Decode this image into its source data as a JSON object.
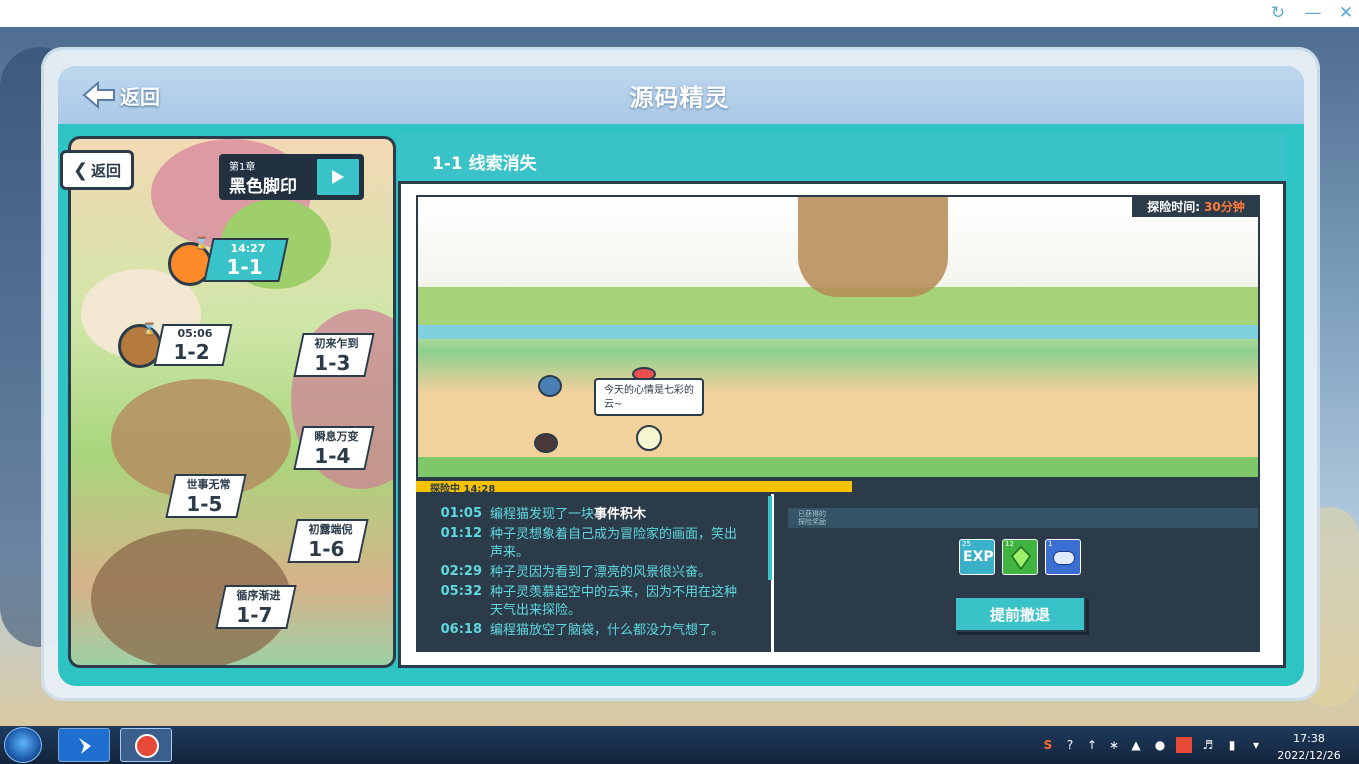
{
  "window": {
    "refresh_icon": "refresh-icon",
    "minimize_label": "—",
    "close_label": "✕"
  },
  "header": {
    "title": "源码精灵",
    "back_label": "返回"
  },
  "map": {
    "back_label": "返回",
    "chapter_number": "第1章",
    "chapter_name": "黑色脚印",
    "stages": [
      {
        "code": "1-1",
        "name": "",
        "time": "14:27",
        "active": true
      },
      {
        "code": "1-2",
        "name": "",
        "time": "05:06",
        "active": false
      },
      {
        "code": "1-3",
        "name": "初来乍到",
        "time": "",
        "active": false
      },
      {
        "code": "1-4",
        "name": "瞬息万变",
        "time": "",
        "active": false
      },
      {
        "code": "1-5",
        "name": "世事无常",
        "time": "",
        "active": false
      },
      {
        "code": "1-6",
        "name": "初露端倪",
        "time": "",
        "active": false
      },
      {
        "code": "1-7",
        "name": "循序渐进",
        "time": "",
        "active": false
      }
    ]
  },
  "content": {
    "title": "1-1 线索消失",
    "explore_time_label": "探险时间:",
    "explore_time_value": "30分钟",
    "speech_bubble": "今天的心情是七彩的云~",
    "progress_label": "探险中 14:28",
    "progress_fraction": 0.516,
    "log": [
      {
        "time": "01:05",
        "text": "编程猫发现了一块",
        "highlight": "事件积木"
      },
      {
        "time": "01:12",
        "text": "种子灵想象着自己成为冒险家的画面，笑出声来。",
        "highlight": ""
      },
      {
        "time": "02:29",
        "text": "种子灵因为看到了漂亮的风景很兴奋。",
        "highlight": ""
      },
      {
        "time": "05:32",
        "text": "种子灵羡慕起空中的云来，因为不用在这种天气出来探险。",
        "highlight": ""
      },
      {
        "time": "06:18",
        "text": "编程猫放空了脑袋，什么都没力气想了。",
        "highlight": ""
      }
    ],
    "rewards": {
      "title_line1": "已获得的",
      "title_line2": "探险奖励",
      "items": [
        {
          "icon": "exp-icon",
          "qty": "25",
          "color": "#3bb0c9"
        },
        {
          "icon": "green-crystal-icon",
          "qty": "12",
          "color": "#3fb43f"
        },
        {
          "icon": "blue-token-icon",
          "qty": "1",
          "color": "#3a6fd1"
        }
      ]
    },
    "retreat_label": "提前撤退"
  },
  "taskbar": {
    "time": "17:38",
    "date": "2022/12/26"
  }
}
